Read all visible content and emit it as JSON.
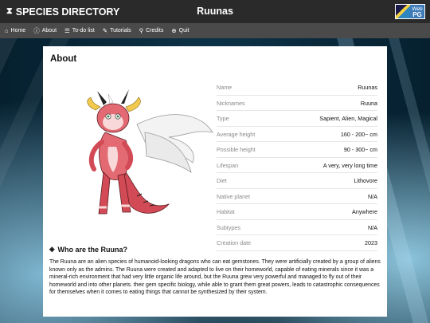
{
  "header": {
    "brand": "SPECIES DIRECTORY",
    "title": "Ruunas",
    "badge_top": "Web",
    "badge_bottom": "PG"
  },
  "nav": [
    {
      "label": "Home",
      "icon": "home-icon"
    },
    {
      "label": "About",
      "icon": "info-icon"
    },
    {
      "label": "To-do list",
      "icon": "list-icon"
    },
    {
      "label": "Tutorials",
      "icon": "wand-icon"
    },
    {
      "label": "Credits",
      "icon": "search-icon"
    },
    {
      "label": "Quit",
      "icon": "plus-circle-icon"
    }
  ],
  "about": {
    "heading": "About",
    "rows": [
      {
        "k": "Name",
        "v": "Ruunas"
      },
      {
        "k": "Nicknames",
        "v": "Ruuna"
      },
      {
        "k": "Type",
        "v": "Sapient, Alien, Magical"
      },
      {
        "k": "Average height",
        "v": "160 - 200~ cm"
      },
      {
        "k": "Possible height",
        "v": "90 - 300~ cm"
      },
      {
        "k": "Lifespan",
        "v": "A very, very long time"
      },
      {
        "k": "Diet",
        "v": "Lithovore"
      },
      {
        "k": "Native planet",
        "v": "N/A"
      },
      {
        "k": "Habitat",
        "v": "Anywhere"
      },
      {
        "k": "Subtypes",
        "v": "N/A"
      },
      {
        "k": "Creation date",
        "v": "2023"
      }
    ]
  },
  "who": {
    "title": "Who are the Ruuna?",
    "text": "The Ruuna are an alien species of humanoid-looking dragons who can eat gemstones. They were artificially created by a group of aliens known only as the admins. The Ruuna were created and adapted to live on their homeworld, capable of eating minerals since it was a mineral-rich environment that had very little organic life around, but the Ruuna grew very powerful and managed to fly out of their homeworld and into other planets. their gem specific biology, while able to grant them great powers, leads to catastrophic consequences for themselves when it comes to eating things that cannot be synthesized by their system."
  }
}
